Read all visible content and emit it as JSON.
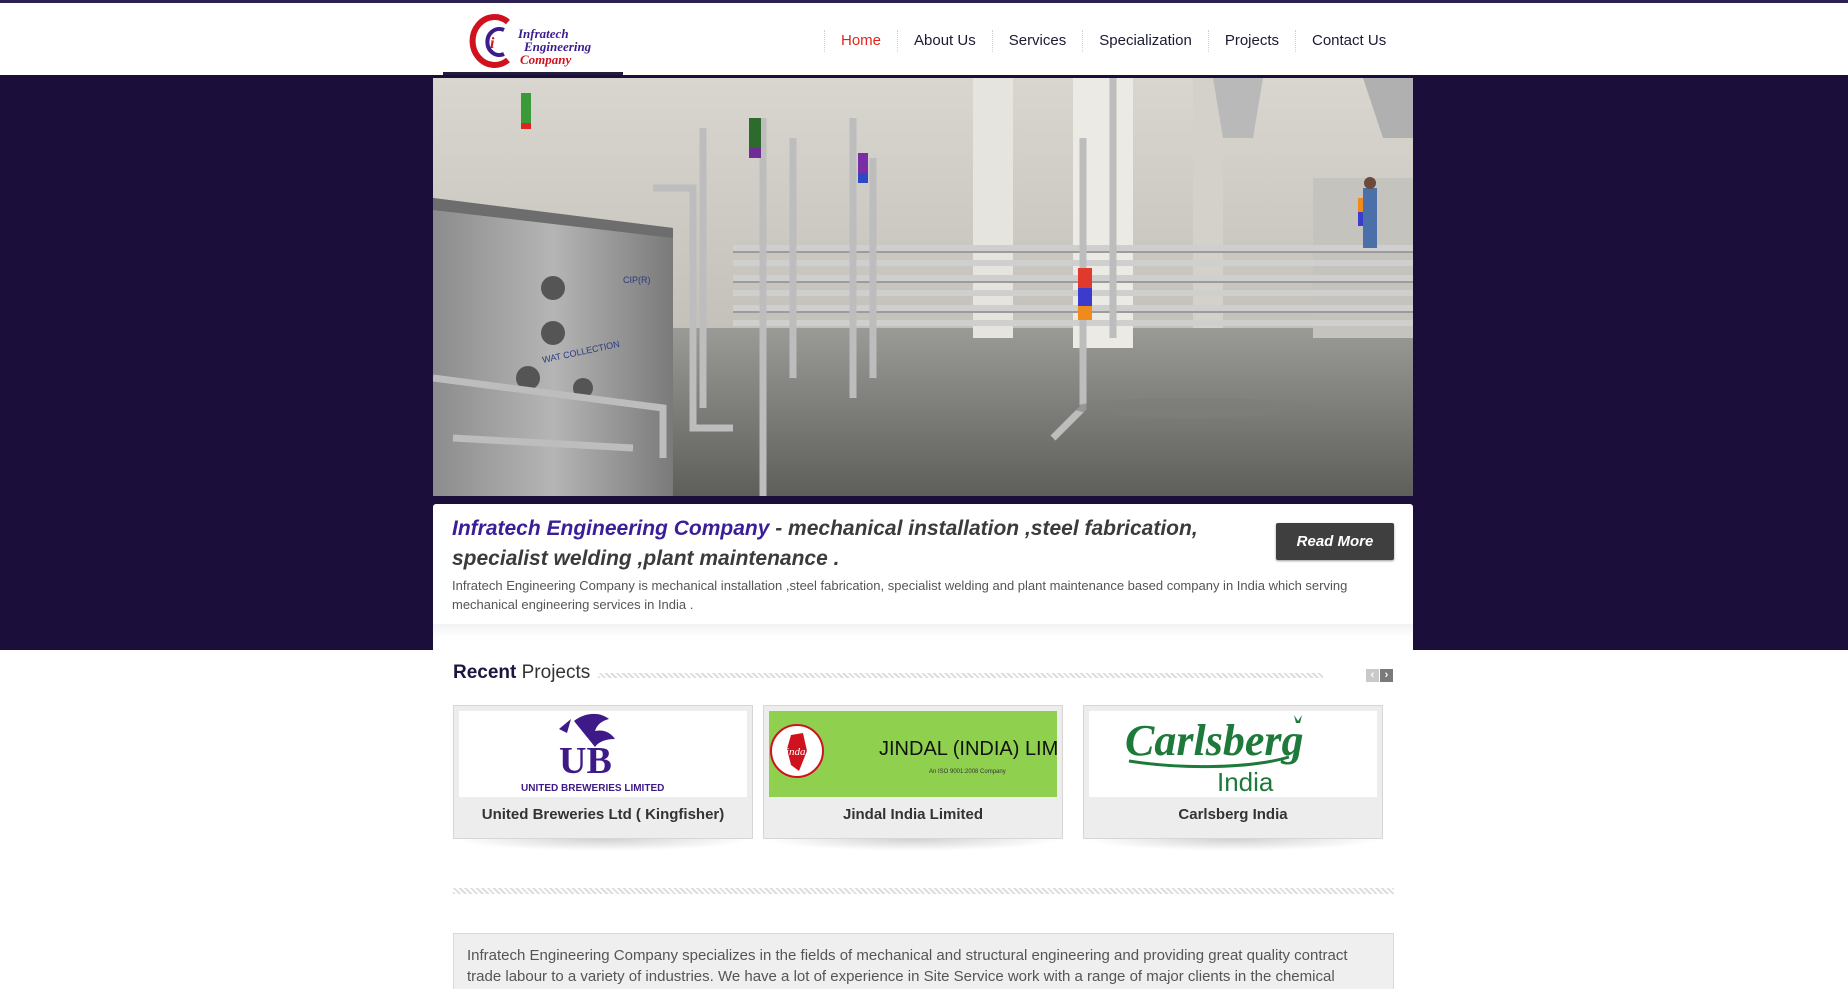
{
  "brand": {
    "logo_line1": "Infratech",
    "logo_line2": "Engineering",
    "logo_line3": "Company",
    "colors": {
      "purple": "#3a1d98",
      "red": "#e0261c",
      "dark_band": "#1c0e3a"
    }
  },
  "nav": {
    "items": [
      "Home",
      "About Us",
      "Services",
      "Specialization",
      "Projects",
      "Contact Us"
    ],
    "active": "Home"
  },
  "hero": {
    "image_icon": "industrial-piping-photo",
    "plate_label_1": "CIP(R)",
    "plate_label_2": "WAT COLLECTION"
  },
  "intro": {
    "brand_name": "Infratech Engineering Company",
    "tagline": " - mechanical installation ,steel fabrication, specialist welding ,plant maintenance .",
    "read_more": "Read More",
    "description": "Infratech Engineering Company is mechanical installation ,steel fabrication, specialist welding and plant maintenance based company in India which serving mechanical engineering services in India ."
  },
  "recent_projects": {
    "title_bold": "Recent",
    "title_rest": " Projects",
    "prev_icon": "chevron-left-icon",
    "next_icon": "chevron-right-icon",
    "items": [
      {
        "title": "United Breweries Ltd ( Kingfisher)",
        "logo_text": "UB",
        "logo_sub": "UNITED BREWERIES LIMITED"
      },
      {
        "title": "Jindal India Limited",
        "logo_text": "JINDAL (INDIA) LIMITED",
        "logo_sub": "An ISO 9001:2008 Company",
        "logo_mark": "Jindal"
      },
      {
        "title": "Carlsberg India",
        "logo_text": "Carlsberg",
        "logo_sub": "India"
      }
    ]
  },
  "about": {
    "text": "Infratech Engineering Company specializes in the fields of mechanical and structural engineering and providing great quality contract trade labour to a variety of industries. We have a lot of experience in Site Service work with a range of major clients in the chemical industries, steel ,"
  }
}
